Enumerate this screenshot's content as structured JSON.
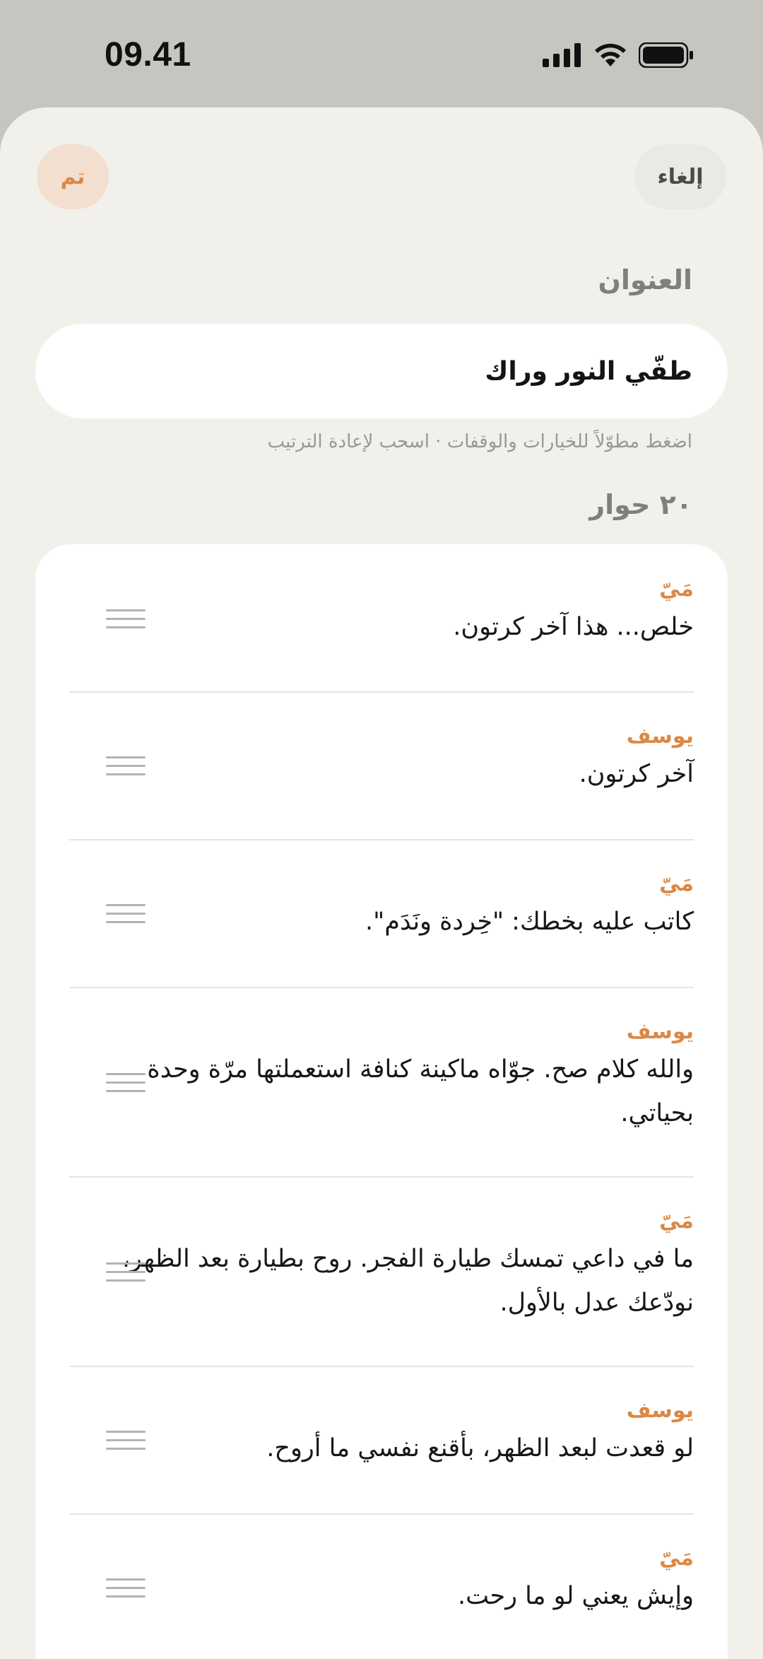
{
  "status_bar": {
    "time": "09.41",
    "icons": [
      "cellular-signal-icon",
      "wifi-icon",
      "battery-icon"
    ]
  },
  "nav": {
    "done_label": "تم",
    "cancel_label": "إلغاء"
  },
  "title_section": {
    "label": "العنوان",
    "value": "طفّي النور وراك"
  },
  "hint": "اضغط مطوّلاً للخيارات والوقفات · اسحب لإعادة الترتيب",
  "dialogue_count_label": "٢٠ حوار",
  "lines": [
    {
      "speaker": "مَيّ",
      "text": "خلص... هذا آخر كرتون."
    },
    {
      "speaker": "يوسف",
      "text": "آخر كرتون."
    },
    {
      "speaker": "مَيّ",
      "text": "كاتب عليه بخطك: \"خِردة ونَدَم\"."
    },
    {
      "speaker": "يوسف",
      "text": "والله كلام صح. جوّاه ماكينة كنافة استعملتها مرّة وحدة بحياتي."
    },
    {
      "speaker": "مَيّ",
      "text": "ما في داعي تمسك طيارة الفجر. روح بطيارة بعد الظهر، نودّعك عدل بالأول."
    },
    {
      "speaker": "يوسف",
      "text": "لو قعدت لبعد الظهر، بأقنع نفسي ما أروح."
    },
    {
      "speaker": "مَيّ",
      "text": "وإيش يعني لو ما رحت."
    }
  ],
  "colors": {
    "accent": "#dc8844",
    "accent_soft": "#f2dfd0",
    "sheet_background": "#f2f0eb",
    "card_background": "#ffffff",
    "backdrop": "#c6c5c0"
  }
}
